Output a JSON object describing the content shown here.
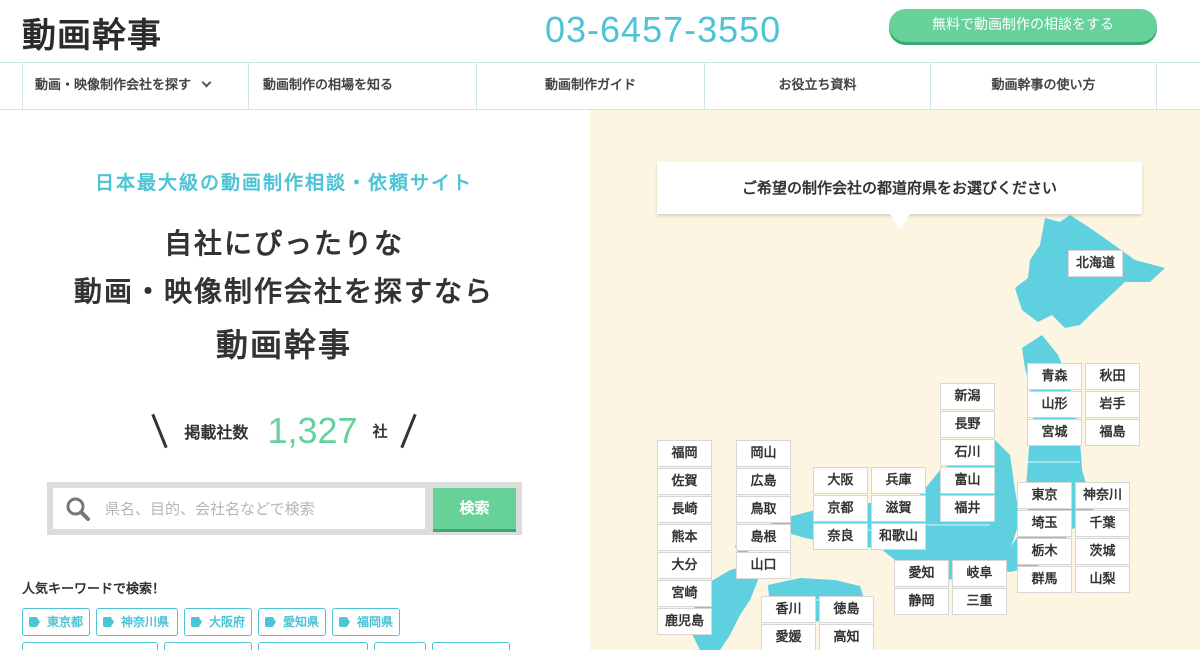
{
  "header": {
    "logo_text": "動画幹事",
    "phone": "03-6457-3550",
    "cta_label": "無料で動画制作の相談をする"
  },
  "nav": {
    "items": [
      {
        "label": "動画・映像制作会社を探す"
      },
      {
        "label": "動画制作の相場を知る"
      },
      {
        "label": "動画制作ガイド"
      },
      {
        "label": "お役立ち資料"
      },
      {
        "label": "動画幹事の使い方"
      }
    ]
  },
  "hero": {
    "tagline": "日本最大級の動画制作相談・依頼サイト",
    "line1": "自社にぴったりな",
    "line2": "動画・映像制作会社を探すなら",
    "line3": "動画幹事",
    "count_label": "掲載社数",
    "count_value": "1,327",
    "count_unit": "社"
  },
  "search": {
    "placeholder": "県名、目的、会社名などで検索",
    "button_label": "検索"
  },
  "popular": {
    "title": "人気キーワードで検索！",
    "tags": [
      "東京都",
      "神奈川県",
      "大阪府",
      "愛知県",
      "福岡県"
    ]
  },
  "map": {
    "title": "ご希望の制作会社の都道府県をお選びください",
    "prefectures": [
      "北海道",
      "青森",
      "秋田",
      "山形",
      "岩手",
      "宮城",
      "福島",
      "新潟",
      "長野",
      "石川",
      "富山",
      "福井",
      "東京",
      "神奈川",
      "埼玉",
      "千葉",
      "栃木",
      "茨城",
      "群馬",
      "山梨",
      "大阪",
      "兵庫",
      "京都",
      "滋賀",
      "奈良",
      "和歌山",
      "愛知",
      "岐阜",
      "静岡",
      "三重",
      "岡山",
      "広島",
      "鳥取",
      "島根",
      "山口",
      "福岡",
      "佐賀",
      "長崎",
      "熊本",
      "大分",
      "宮崎",
      "鹿児島",
      "香川",
      "徳島",
      "愛媛",
      "高知"
    ]
  },
  "colors": {
    "accent_blue": "#4dc3d6",
    "accent_green": "#66d29a",
    "map_bg": "#fbf5e1"
  }
}
